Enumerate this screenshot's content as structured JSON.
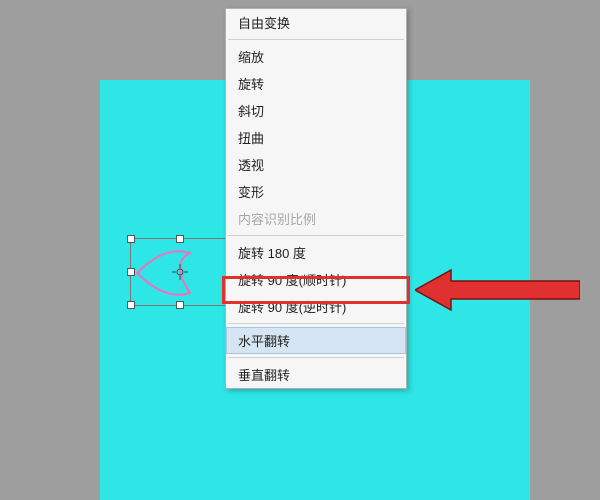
{
  "menu": {
    "free_transform": "自由变换",
    "scale": "缩放",
    "rotate": "旋转",
    "skew": "斜切",
    "distort": "扭曲",
    "perspective": "透视",
    "warp": "变形",
    "content_aware_scale": "内容识别比例",
    "rotate_180": "旋转 180 度",
    "rotate_90_cw": "旋转 90 度(顺时针)",
    "rotate_90_ccw": "旋转 90 度(逆时针)",
    "flip_horizontal": "水平翻转",
    "flip_vertical": "垂直翻转"
  }
}
